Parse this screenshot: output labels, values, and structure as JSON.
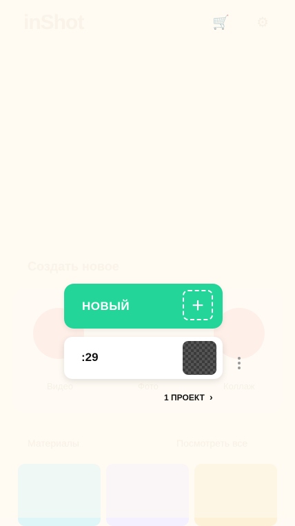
{
  "app": {
    "logo": "inShot"
  },
  "background": {
    "create_title": "Создать новое",
    "sections": [
      "Материалы",
      "Посмотреть все"
    ],
    "circle_labels": [
      "Видео",
      "Фото",
      "Коллаж"
    ]
  },
  "popup": {
    "new_label": "НОВЫЙ",
    "plus_symbol": "+",
    "project_duration": ":29",
    "projects_link": "1 ПРОЕКТ",
    "chevron": "›"
  },
  "colors": {
    "accent": "#23d598"
  }
}
